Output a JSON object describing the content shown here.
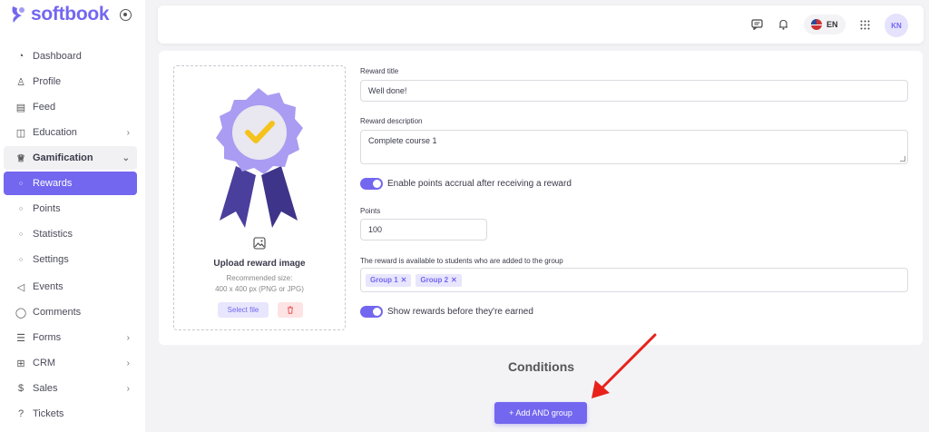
{
  "brand": {
    "name": "softbook"
  },
  "sidebar": {
    "items": [
      {
        "label": "Dashboard",
        "icon": "gauge-icon"
      },
      {
        "label": "Profile",
        "icon": "user-icon"
      },
      {
        "label": "Feed",
        "icon": "feed-icon"
      },
      {
        "label": "Education",
        "icon": "book-icon"
      },
      {
        "label": "Gamification",
        "icon": "trophy-icon"
      },
      {
        "label": "Rewards",
        "icon": "circle-icon"
      },
      {
        "label": "Points",
        "icon": "circle-icon"
      },
      {
        "label": "Statistics",
        "icon": "circle-icon"
      },
      {
        "label": "Settings",
        "icon": "circle-icon"
      },
      {
        "label": "Events",
        "icon": "megaphone-icon"
      },
      {
        "label": "Comments",
        "icon": "comment-icon"
      },
      {
        "label": "Forms",
        "icon": "list-icon"
      },
      {
        "label": "CRM",
        "icon": "grid-icon"
      },
      {
        "label": "Sales",
        "icon": "dollar-icon"
      },
      {
        "label": "Tickets",
        "icon": "help-icon"
      }
    ]
  },
  "topbar": {
    "language": "EN",
    "avatar_initials": "KN"
  },
  "upload": {
    "title": "Upload reward image",
    "hint_line1": "Recommended size:",
    "hint_line2": "400 x 400 px (PNG or JPG)",
    "select_label": "Select file"
  },
  "form": {
    "title_label": "Reward title",
    "title_value": "Well done!",
    "description_label": "Reward description",
    "description_value": "Complete course 1",
    "enable_points_label": "Enable points accrual after receiving a reward",
    "enable_points_on": true,
    "points_label": "Points",
    "points_value": "100",
    "groups_label": "The reward is available to students who are added to the group",
    "groups": [
      "Group 1",
      "Group 2"
    ],
    "show_rewards_label": "Show rewards before they're earned",
    "show_rewards_on": true
  },
  "conditions": {
    "title": "Conditions",
    "add_group_label": "+ Add AND group"
  },
  "colors": {
    "accent": "#7367f0",
    "arrow": "#e8221b",
    "danger": "#ea5455"
  }
}
